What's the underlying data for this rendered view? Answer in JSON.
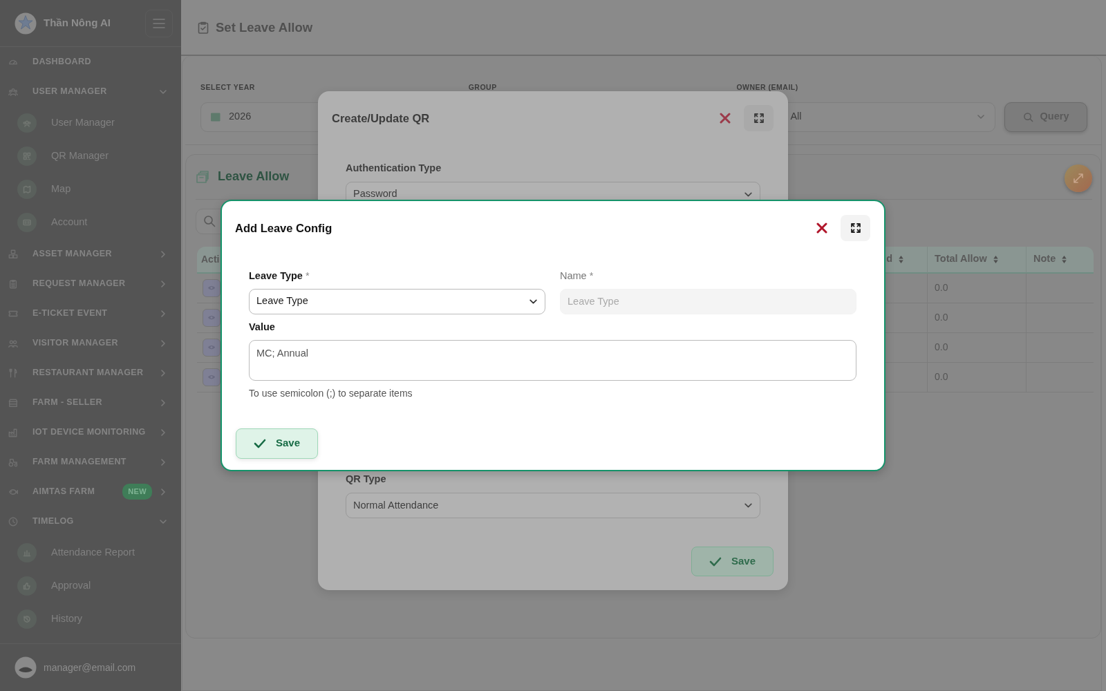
{
  "sidebar": {
    "brand": "Thần Nông AI",
    "items": [
      {
        "label": "DASHBOARD"
      },
      {
        "label": "USER MANAGER",
        "expanded": true,
        "children": [
          {
            "label": "User Manager"
          },
          {
            "label": "QR Manager"
          },
          {
            "label": "Map"
          },
          {
            "label": "Account"
          }
        ]
      },
      {
        "label": "ASSET MANAGER",
        "expanded": false
      },
      {
        "label": "REQUEST MANAGER",
        "expanded": false
      },
      {
        "label": "E-TICKET EVENT",
        "expanded": false
      },
      {
        "label": "VISITOR MANAGER",
        "expanded": false
      },
      {
        "label": "RESTAURANT MANAGER",
        "expanded": false
      },
      {
        "label": "FARM - SELLER",
        "expanded": false
      },
      {
        "label": "IOT DEVICE MONITORING",
        "expanded": false
      },
      {
        "label": "FARM MANAGEMENT",
        "expanded": false
      },
      {
        "label": "AIMTAS FARM",
        "badge": "NEW",
        "expanded": false
      },
      {
        "label": "TIMELOG",
        "expanded": true,
        "children": [
          {
            "label": "Attendance Report"
          },
          {
            "label": "Approval"
          },
          {
            "label": "History"
          }
        ]
      }
    ],
    "user": "manager@email.com"
  },
  "header": {
    "title": "Set Leave Allow"
  },
  "filters": [
    {
      "label": "SELECT YEAR",
      "kind": "date",
      "value": "2026"
    },
    {
      "label": "GROUP",
      "kind": "hidden"
    },
    {
      "label": "OWNER (EMAIL)",
      "kind": "select",
      "value": "All"
    }
  ],
  "query_button": "Query",
  "leave_allow": {
    "title": "Leave Allow",
    "columns": [
      {
        "label": "Acti"
      },
      {
        "label": "d",
        "sortable": true
      },
      {
        "label": "Total Allow",
        "sortable": true
      },
      {
        "label": "Note",
        "sortable": true
      }
    ],
    "rows": [
      {
        "total_allow": "0.0"
      },
      {
        "total_allow": "0.0"
      },
      {
        "total_allow": "0.0"
      },
      {
        "total_allow": "0.0"
      }
    ]
  },
  "qr_modal": {
    "title": "Create/Update QR",
    "fields": [
      {
        "label": "Authentication Type",
        "value": "Password"
      },
      {
        "label": "QR Type",
        "value": "Normal Attendance"
      }
    ],
    "save_button": "Save"
  },
  "leave_modal": {
    "title": "Add Leave Config",
    "fields": [
      {
        "label": "Leave Type",
        "required_mark": "*",
        "kind": "select",
        "value": "Leave Type",
        "disabled": false
      },
      {
        "label": "Name",
        "required_mark": "*",
        "kind": "text",
        "placeholder": "Leave Type",
        "disabled": true
      },
      {
        "label": "Value",
        "kind": "textarea",
        "placeholder": "MC; Annual",
        "disabled": false
      }
    ],
    "hint": "To use semicolon (;) to separate items",
    "save_button": "Save"
  }
}
